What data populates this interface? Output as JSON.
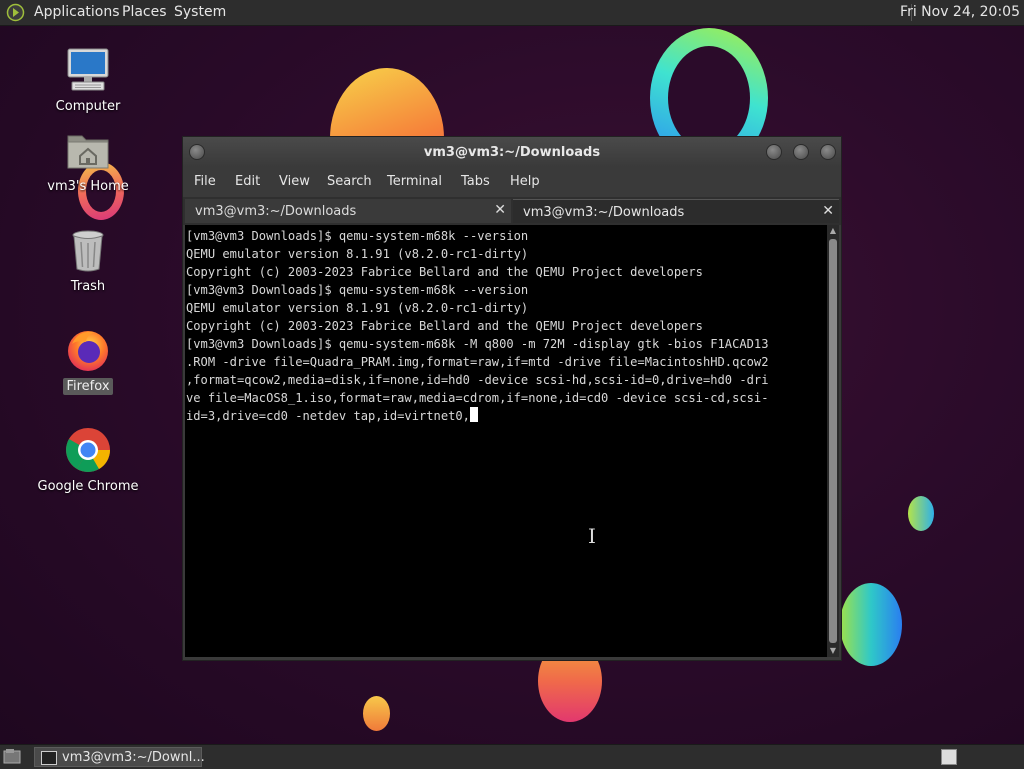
{
  "top_panel": {
    "menus": [
      "Applications",
      "Places",
      "System"
    ],
    "clock": "Fri Nov 24, 20:05"
  },
  "desktop_icons": [
    {
      "label": "Computer",
      "icon": "computer-icon"
    },
    {
      "label": "vm3's Home",
      "icon": "home-folder-icon"
    },
    {
      "label": "Trash",
      "icon": "trash-icon"
    },
    {
      "label": "Firefox",
      "icon": "firefox-icon"
    },
    {
      "label": "Google Chrome",
      "icon": "chrome-icon"
    }
  ],
  "window": {
    "title": "vm3@vm3:~/Downloads",
    "menu": [
      "File",
      "Edit",
      "View",
      "Search",
      "Terminal",
      "Tabs",
      "Help"
    ],
    "tabs": [
      {
        "label": "vm3@vm3:~/Downloads",
        "active": false
      },
      {
        "label": "vm3@vm3:~/Downloads",
        "active": true
      }
    ],
    "terminal_lines": [
      "[vm3@vm3 Downloads]$ qemu-system-m68k --version",
      "QEMU emulator version 8.1.91 (v8.2.0-rc1-dirty)",
      "Copyright (c) 2003-2023 Fabrice Bellard and the QEMU Project developers",
      "[vm3@vm3 Downloads]$ qemu-system-m68k --version",
      "QEMU emulator version 8.1.91 (v8.2.0-rc1-dirty)",
      "Copyright (c) 2003-2023 Fabrice Bellard and the QEMU Project developers",
      "[vm3@vm3 Downloads]$ qemu-system-m68k -M q800 -m 72M -display gtk -bios F1ACAD13",
      ".ROM -drive file=Quadra_PRAM.img,format=raw,if=mtd -drive file=MacintoshHD.qcow2",
      ",format=qcow2,media=disk,if=none,id=hd0 -device scsi-hd,scsi-id=0,drive=hd0 -dri",
      "ve file=MacOS8_1.iso,format=raw,media=cdrom,if=none,id=cd0 -device scsi-cd,scsi-"
    ],
    "current_input": "id=3,drive=cd0 -netdev tap,id=virtnet0,"
  },
  "taskbar": {
    "task_label": "vm3@vm3:~/Downl..."
  }
}
